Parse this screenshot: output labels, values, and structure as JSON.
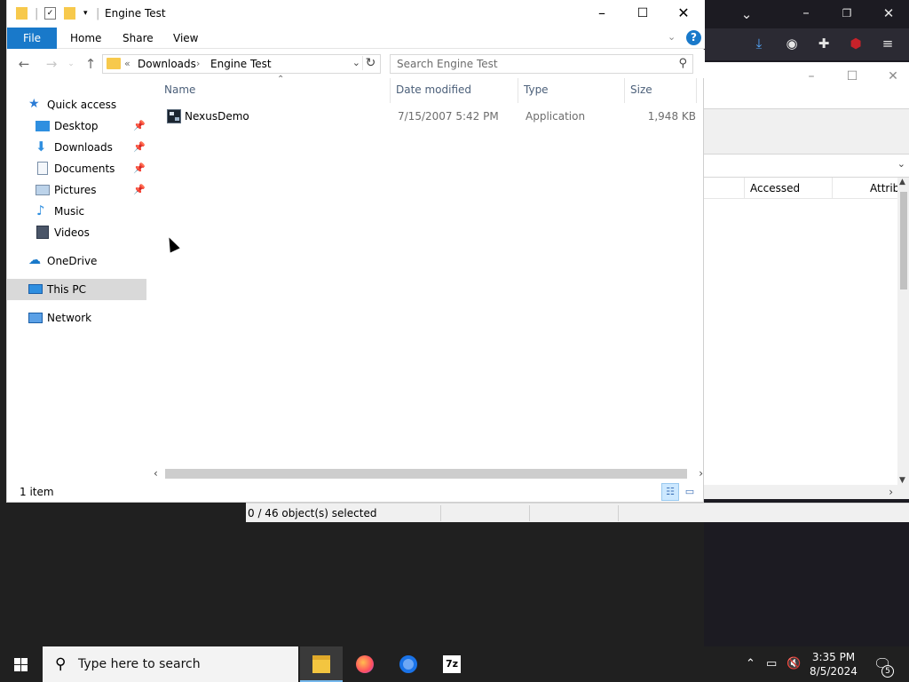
{
  "explorer": {
    "title": "Engine Test",
    "ribbon_tabs": [
      "File",
      "Home",
      "Share",
      "View"
    ],
    "help_label": "?",
    "address": {
      "overflow": "«",
      "crumbs": [
        "Downloads",
        "Engine Test"
      ]
    },
    "search": {
      "placeholder": "Search Engine Test"
    },
    "nav_pane": {
      "items": [
        {
          "label": "Quick access",
          "icon": "star-icon",
          "pinned": false
        },
        {
          "label": "Desktop",
          "icon": "desktop-icon",
          "pinned": true
        },
        {
          "label": "Downloads",
          "icon": "download-icon",
          "pinned": true
        },
        {
          "label": "Documents",
          "icon": "document-icon",
          "pinned": true
        },
        {
          "label": "Pictures",
          "icon": "pictures-icon",
          "pinned": true
        },
        {
          "label": "Music",
          "icon": "music-icon",
          "pinned": false
        },
        {
          "label": "Videos",
          "icon": "videos-icon",
          "pinned": false
        },
        {
          "label": "OneDrive",
          "icon": "cloud-icon",
          "pinned": false
        },
        {
          "label": "This PC",
          "icon": "computer-icon",
          "pinned": false,
          "selected": true
        },
        {
          "label": "Network",
          "icon": "network-icon",
          "pinned": false
        }
      ]
    },
    "columns": [
      "Name",
      "Date modified",
      "Type",
      "Size"
    ],
    "files": [
      {
        "name": "NexusDemo",
        "date_modified": "7/15/2007 5:42 PM",
        "type": "Application",
        "size": "1,948 KB",
        "icon": "application-icon"
      }
    ],
    "status": "1 item"
  },
  "zip_window": {
    "columns": [
      "Accessed",
      "Attrib"
    ],
    "status": "0 / 46 object(s) selected"
  },
  "taskbar": {
    "search_placeholder": "Type here to search",
    "apps": [
      "file-explorer",
      "firefox",
      "chromium",
      "7-zip"
    ],
    "seven_zip_label": "7z",
    "clock_time": "3:35 PM",
    "clock_date": "8/5/2024",
    "notification_count": "5"
  },
  "colors": {
    "accent": "#1979ca",
    "taskbar": "#202020",
    "selection": "#d9d9d9"
  }
}
